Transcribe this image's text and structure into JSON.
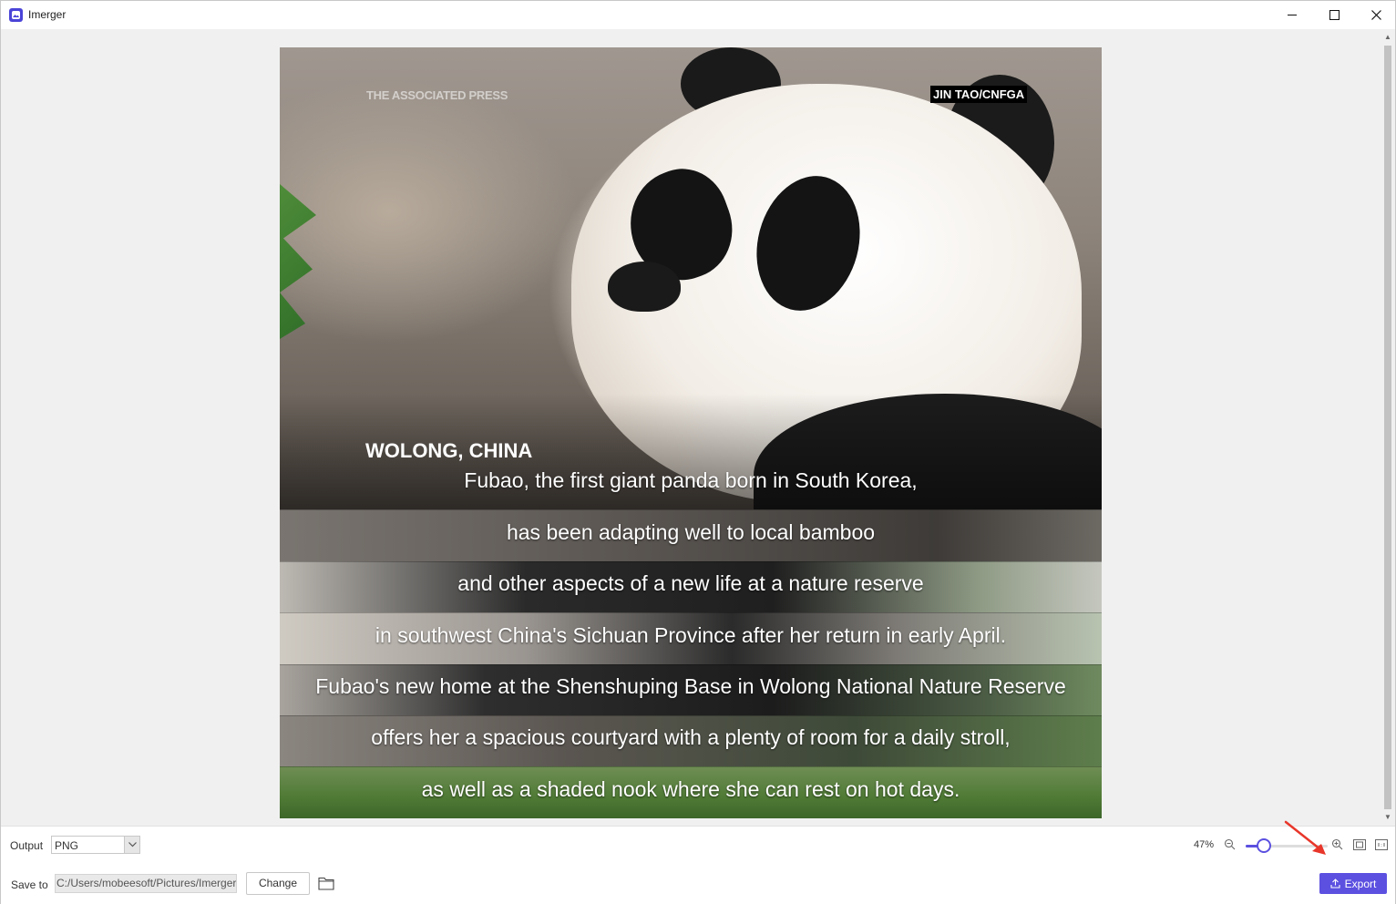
{
  "window": {
    "title": "Imerger",
    "controls": [
      "minimize",
      "maximize",
      "close"
    ]
  },
  "image": {
    "watermark_left": "THE ASSOCIATED PRESS",
    "watermark_credit": "JIN TAO/CNFGA",
    "location": "WOLONG, CHINA",
    "subtitles": [
      "Fubao, the first giant panda born in South Korea,",
      "has been adapting well to local bamboo",
      "and other aspects of a new life at a nature reserve",
      "in southwest China's Sichuan Province after her return in early April.",
      "Fubao's new home at the Shenshuping Base in Wolong National Nature Reserve",
      "offers her a spacious courtyard with a plenty of room for a daily stroll,",
      "as well as a shaded nook where she can rest on hot days."
    ]
  },
  "bottom_bar": {
    "output_label": "Output",
    "output_format": "PNG",
    "save_label": "Save to",
    "save_path": "C:/Users/mobeesoft/Pictures/Imerger",
    "change_label": "Change",
    "zoom_value": "47%",
    "zoom_fraction": 0.47,
    "export_label": "Export"
  },
  "colors": {
    "accent": "#5b50e0",
    "annotation": "#e8362a"
  },
  "icons": [
    "app-icon",
    "minimize-icon",
    "maximize-icon",
    "close-icon",
    "chevron-down-icon",
    "folder-icon",
    "zoom-out-icon",
    "zoom-in-icon",
    "fit-screen-icon",
    "actual-size-icon",
    "upload-icon",
    "annotation-arrow-icon"
  ]
}
